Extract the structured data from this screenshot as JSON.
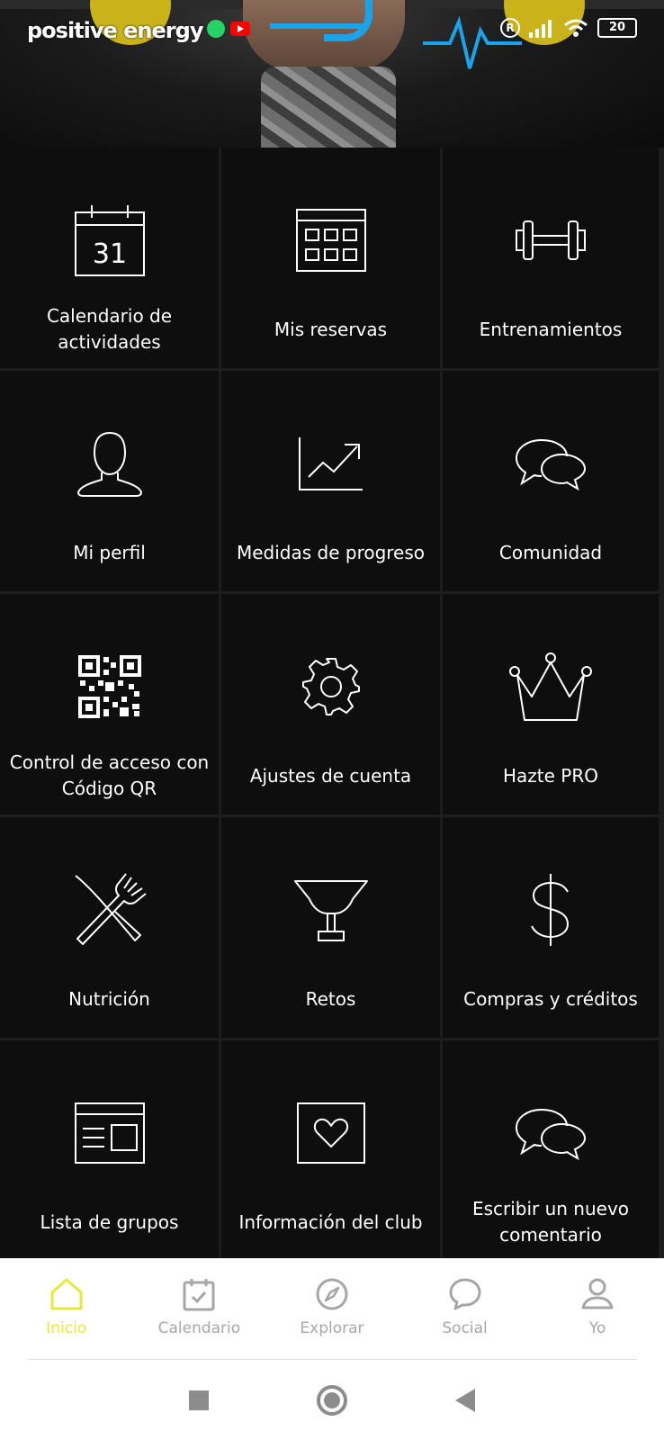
{
  "status_bar": {
    "time": "positive energy",
    "battery": "20",
    "r_badge": "R"
  },
  "tiles": [
    {
      "label": "Calendario de actividades",
      "icon": "calendar-31-icon",
      "calendar_day": "31"
    },
    {
      "label": "Mis reservas",
      "icon": "reservations-grid-icon"
    },
    {
      "label": "Entrenamientos",
      "icon": "dumbbell-icon"
    },
    {
      "label": "Mi perfil",
      "icon": "user-icon"
    },
    {
      "label": "Medidas de progreso",
      "icon": "progress-chart-icon"
    },
    {
      "label": "Comunidad",
      "icon": "chat-bubbles-icon"
    },
    {
      "label": "Control de acceso con Código QR",
      "icon": "qr-code-icon"
    },
    {
      "label": "Ajustes de cuenta",
      "icon": "gear-icon"
    },
    {
      "label": "Hazte PRO",
      "icon": "crown-icon"
    },
    {
      "label": "Nutrición",
      "icon": "knife-fork-icon"
    },
    {
      "label": "Retos",
      "icon": "trophy-icon"
    },
    {
      "label": "Compras y créditos",
      "icon": "dollar-icon"
    },
    {
      "label": "Lista de grupos",
      "icon": "group-list-icon"
    },
    {
      "label": "Información del club",
      "icon": "club-heart-icon"
    },
    {
      "label": "Escribir un nuevo comentario",
      "icon": "comment-bubbles-icon"
    }
  ],
  "bottom_nav": [
    {
      "label": "Inicio",
      "icon": "home-icon",
      "active": true
    },
    {
      "label": "Calendario",
      "icon": "calendar-check-icon",
      "active": false
    },
    {
      "label": "Explorar",
      "icon": "compass-icon",
      "active": false
    },
    {
      "label": "Social",
      "icon": "speech-bubble-icon",
      "active": false
    },
    {
      "label": "Yo",
      "icon": "person-icon",
      "active": false
    }
  ],
  "colors": {
    "accent": "#e8e839",
    "background": "#0e0e0e",
    "nav_inactive": "#a6a6a6"
  }
}
